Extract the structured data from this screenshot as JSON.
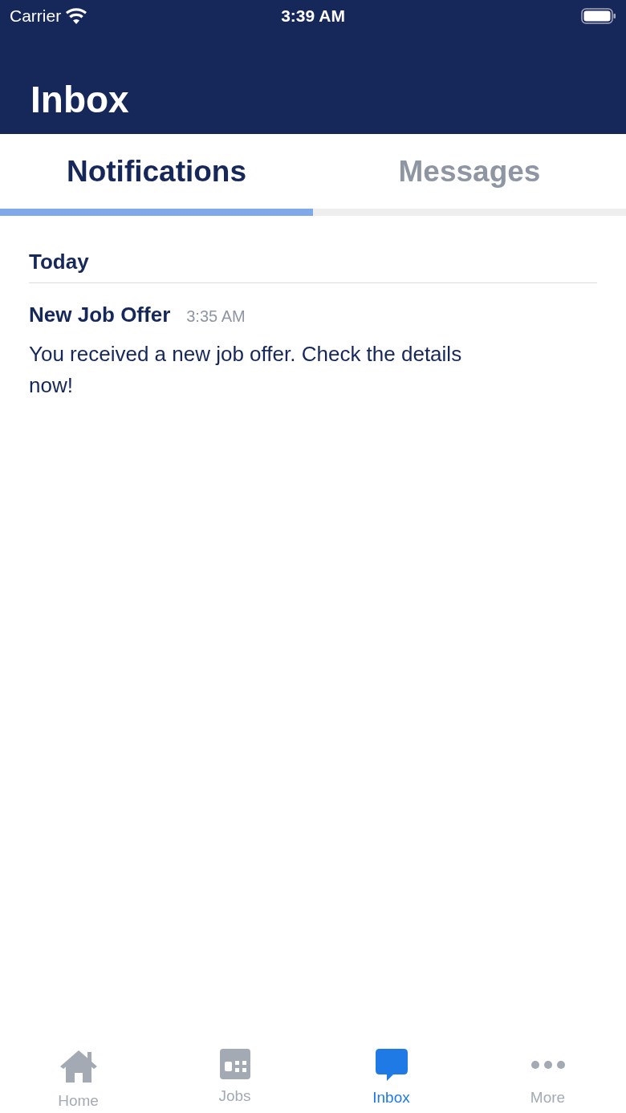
{
  "status_bar": {
    "carrier": "Carrier",
    "time": "3:39 AM"
  },
  "header": {
    "title": "Inbox"
  },
  "tabs": [
    {
      "label": "Notifications",
      "selected": true
    },
    {
      "label": "Messages",
      "selected": false
    }
  ],
  "sections": [
    {
      "title": "Today",
      "items": [
        {
          "title": "New Job Offer",
          "time": "3:35 AM",
          "body": "You received a new job offer. Check the details now!"
        }
      ]
    }
  ],
  "tab_bar": [
    {
      "kind": "home",
      "label": "Home",
      "selected": false
    },
    {
      "kind": "jobs",
      "label": "Jobs",
      "selected": false
    },
    {
      "kind": "inbox",
      "label": "Inbox",
      "selected": true
    },
    {
      "kind": "more",
      "label": "More",
      "selected": false
    }
  ]
}
